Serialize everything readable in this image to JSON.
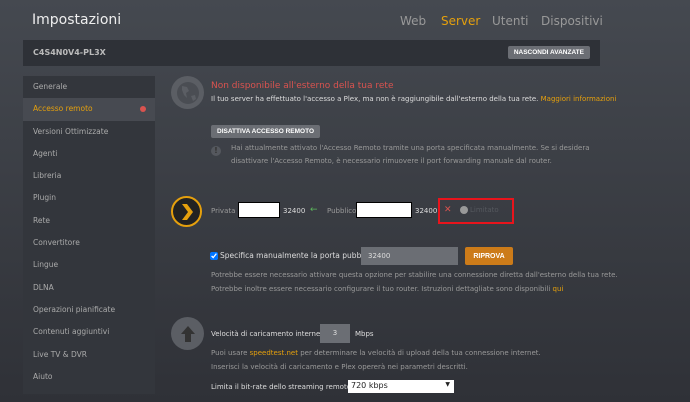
{
  "header": {
    "title": "Impostazioni",
    "tabs": [
      "Web",
      "Server",
      "Utenti",
      "Dispositivi"
    ],
    "active_tab": "Server"
  },
  "bar": {
    "server_name": "C4S4N0V4-PL3X",
    "hide_advanced": "NASCONDI AVANZATE"
  },
  "sidebar": {
    "items": [
      "Generale",
      "Accesso remoto",
      "Versioni Ottimizzate",
      "Agenti",
      "Libreria",
      "Plugin",
      "Rete",
      "Convertitore",
      "Lingue",
      "DLNA",
      "Operazioni pianificate",
      "Contenuti aggiuntivi",
      "Live TV & DVR",
      "Aiuto"
    ],
    "active": "Accesso remoto"
  },
  "status": {
    "title": "Non disponibile all'esterno della tua rete",
    "desc": "Il tuo server ha effettuato l'accesso a Plex, ma non è raggiungibile dall'esterno della tua rete.",
    "more": "Maggiori informazioni",
    "disable_button": "DISATTIVA ACCESSO REMOTO",
    "note_line1": "Hai attualmente attivato l'Accesso Remoto tramite una porta specificata manualmente. Se si desidera",
    "note_line2": "disattivare l'Accesso Remoto, è necessario rimuovere il port forwarding manuale dal router."
  },
  "ports": {
    "private_label": "Privata",
    "private_port": "32400",
    "public_label": "Pubblico",
    "public_port": "32400",
    "status_text": "Limitato",
    "manual_label": "Specifica manualmente la porta pubblica",
    "manual_value": "32400",
    "retry": "RIPROVA",
    "help1": "Potrebbe essere necessario attivare questa opzione per stabilire una connessione diretta dall'esterno della tua rete.",
    "help2": "Potrebbe inoltre essere necessario configurare il tuo router. Istruzioni dettagliate sono disponibili",
    "help_link": "qui"
  },
  "upload": {
    "label": "Velocità di caricamento internet",
    "value": "3",
    "unit": "Mbps",
    "help1a": "Puoi usare",
    "help_link": "speedtest.net",
    "help1b": "per determinare la velocità di upload della tua connessione internet.",
    "help2": "Inserisci la velocità di caricamento e Plex opererà nei parametri descritti.",
    "limit_label": "Limita il bit-rate dello streaming remoto",
    "limit_value": "720 kbps"
  }
}
